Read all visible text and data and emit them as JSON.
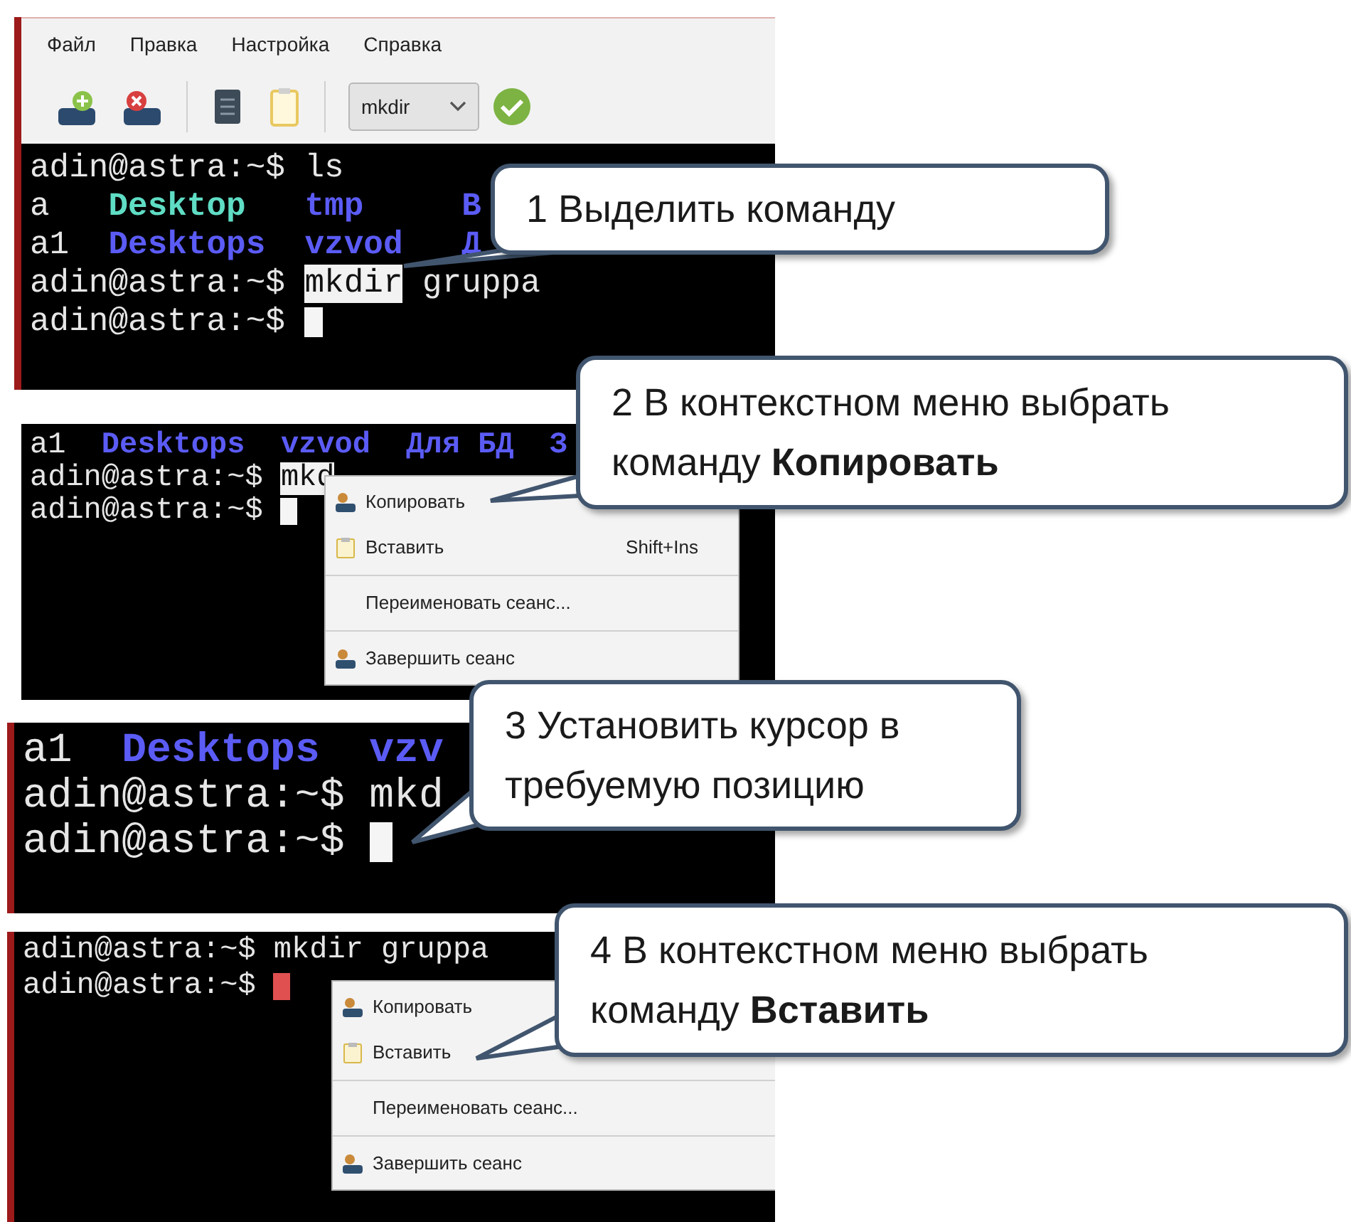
{
  "menu_bar": [
    "Файл",
    "Правка",
    "Настройка",
    "Справка"
  ],
  "toolbar": {
    "command": "mkdir"
  },
  "panels": [
    {
      "lines": [
        {
          "segments": [
            {
              "text": "adin@astra:~$ ls",
              "color": "#e6e6e6",
              "bold": false,
              "selected": false
            }
          ]
        },
        {
          "segments": [
            {
              "text": "a",
              "color": "#e6e6e6",
              "bold": false,
              "selected": false
            },
            {
              "text": "   Desktop",
              "color": "#5fdcc4",
              "bold": true,
              "selected": false
            },
            {
              "text": "   tmp",
              "color": "#5b5bf5",
              "bold": true,
              "selected": false
            },
            {
              "text": "     B",
              "color": "#5b5bf5",
              "bold": true,
              "selected": false
            }
          ]
        },
        {
          "segments": [
            {
              "text": "a1",
              "color": "#e6e6e6",
              "bold": false,
              "selected": false
            },
            {
              "text": "  Desktops",
              "color": "#5b5bf5",
              "bold": true,
              "selected": false
            },
            {
              "text": "  vzvod",
              "color": "#5b5bf5",
              "bold": true,
              "selected": false
            },
            {
              "text": "   Д",
              "color": "#5b5bf5",
              "bold": true,
              "selected": false
            }
          ]
        },
        {
          "segments": [
            {
              "text": "adin@astra:~$ ",
              "color": "#e6e6e6",
              "bold": false,
              "selected": false
            },
            {
              "text": "mkdir",
              "color": "#111111",
              "bold": false,
              "selected": true
            },
            {
              "text": " gruppa",
              "color": "#e6e6e6",
              "bold": false,
              "selected": false
            }
          ]
        },
        {
          "segments": [
            {
              "text": "adin@astra:~$ ",
              "color": "#e6e6e6",
              "bold": false,
              "selected": false
            }
          ],
          "cursor": true,
          "cursor_selected": false
        }
      ]
    },
    {
      "lines": [
        {
          "segments": [
            {
              "text": "a1",
              "color": "#e6e6e6",
              "bold": false,
              "selected": false
            },
            {
              "text": "  Desktops",
              "color": "#5b5bf5",
              "bold": true,
              "selected": false
            },
            {
              "text": "  vzvod",
              "color": "#5b5bf5",
              "bold": true,
              "selected": false
            },
            {
              "text": "  Для БД",
              "color": "#5b5bf5",
              "bold": true,
              "selected": false
            },
            {
              "text": "  З",
              "color": "#5b5bf5",
              "bold": true,
              "selected": false
            }
          ]
        },
        {
          "segments": [
            {
              "text": "adin@astra:~$ ",
              "color": "#e6e6e6",
              "bold": false,
              "selected": false
            },
            {
              "text": "mkd",
              "color": "#111111",
              "bold": false,
              "selected": true
            }
          ]
        },
        {
          "segments": [
            {
              "text": "adin@astra:~$ ",
              "color": "#e6e6e6",
              "bold": false,
              "selected": false
            }
          ],
          "cursor": true,
          "cursor_selected": false
        }
      ],
      "context_menu": [
        {
          "label": "Копировать"
        },
        {
          "label": "Вставить",
          "shortcut": "Shift+Ins"
        },
        {
          "label": "Переименовать сеанс..."
        },
        {
          "label": "Завершить сеанс"
        }
      ]
    },
    {
      "lines": [
        {
          "segments": [
            {
              "text": "a1",
              "color": "#e6e6e6",
              "bold": false,
              "selected": false
            },
            {
              "text": "  Desktops",
              "color": "#5b5bf5",
              "bold": true,
              "selected": false
            },
            {
              "text": "  vzv",
              "color": "#5b5bf5",
              "bold": true,
              "selected": false
            }
          ]
        },
        {
          "segments": [
            {
              "text": "adin@astra:~$ mkd",
              "color": "#e6e6e6",
              "bold": false,
              "selected": false
            }
          ]
        },
        {
          "segments": [
            {
              "text": "adin@astra:~$ ",
              "color": "#e6e6e6",
              "bold": false,
              "selected": false
            }
          ],
          "cursor": true,
          "cursor_selected": false
        }
      ]
    },
    {
      "lines": [
        {
          "segments": [
            {
              "text": "adin@astra:~$ mkdir gruppa",
              "color": "#e6e6e6",
              "bold": false,
              "selected": false
            }
          ]
        },
        {
          "segments": [
            {
              "text": "adin@astra:~$ ",
              "color": "#e6e6e6",
              "bold": false,
              "selected": false
            }
          ],
          "cursor": true,
          "cursor_selected": true
        }
      ],
      "context_menu": [
        {
          "label": "Копировать"
        },
        {
          "label": "Вставить"
        },
        {
          "label": "Переименовать сеанс..."
        },
        {
          "label": "Завершить сеанс"
        }
      ]
    }
  ],
  "callouts": [
    {
      "text": "1 Выделить команду"
    },
    {
      "text": "2 В контекстном меню выбрать команду **Копировать**"
    },
    {
      "text": "3 Установить курсор в требуемую позицию"
    },
    {
      "text": "4 В контекстном меню выбрать команду **Вставить**"
    }
  ]
}
